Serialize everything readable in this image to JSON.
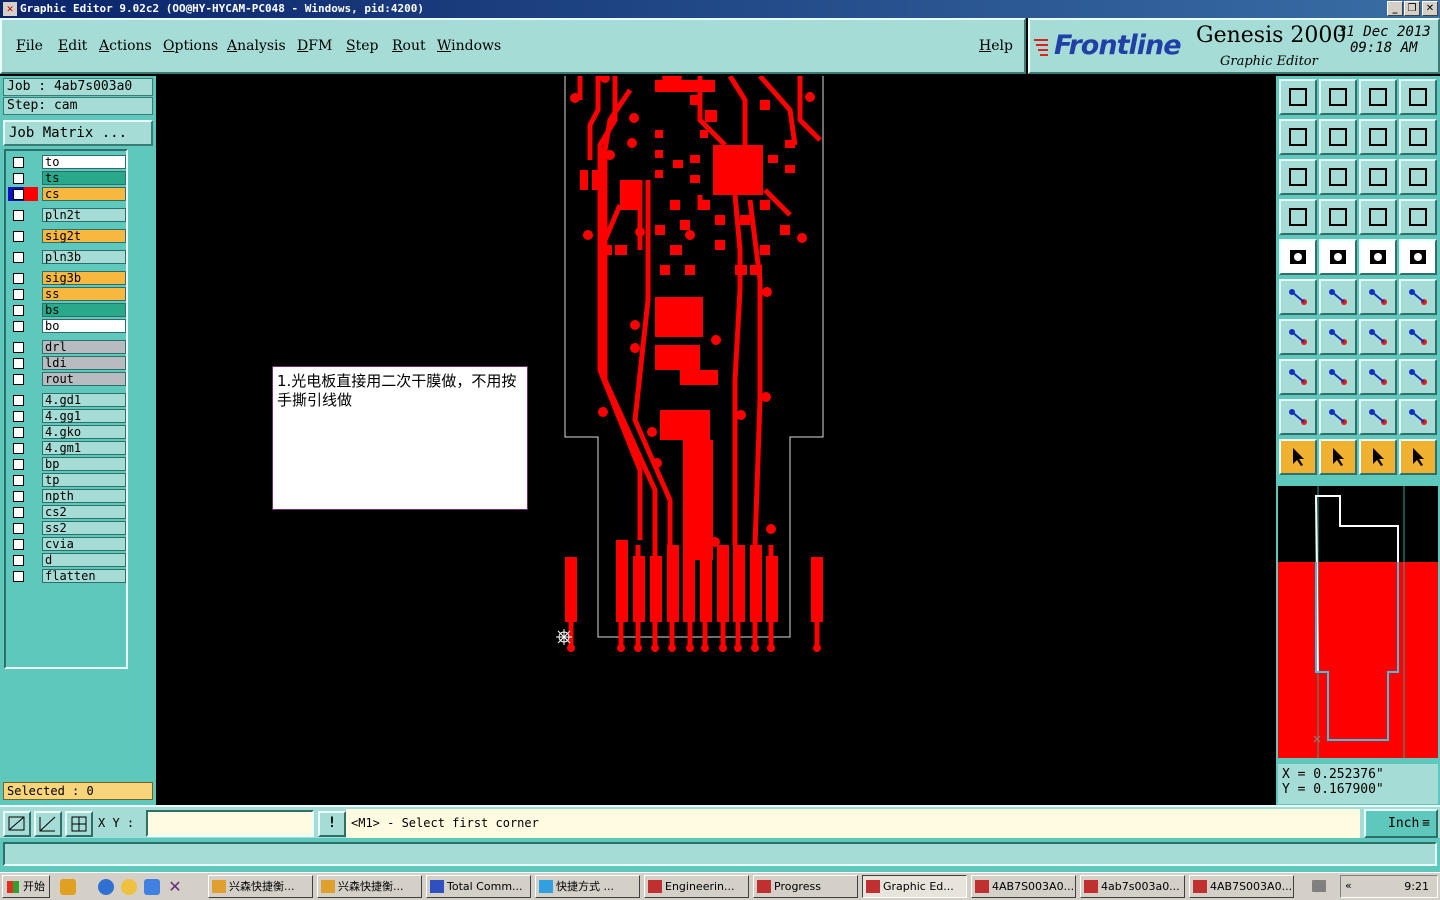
{
  "window": {
    "title": "Graphic Editor 9.02c2  (OO@HY-HYCAM-PC048 - Windows, pid:4200)",
    "buttons": {
      "minimize": "_",
      "maximize": "❐",
      "close": "✕"
    }
  },
  "menu": {
    "items": [
      "File",
      "Edit",
      "Actions",
      "Options",
      "Analysis",
      "DFM",
      "Step",
      "Rout",
      "Windows"
    ],
    "help": "Help"
  },
  "banner": {
    "logo": "Frontline",
    "product": "Genesis 2000",
    "subtitle": "Graphic Editor",
    "date": "31 Dec 2013",
    "time": "09:18 AM"
  },
  "job": {
    "job_line": "Job : 4ab7s003a0",
    "step_line": "Step: cam",
    "matrix_button": "Job Matrix ..."
  },
  "layers": [
    {
      "name": "to",
      "color": "#ffffff"
    },
    {
      "name": "ts",
      "color": "#2aa88a"
    },
    {
      "name": "cs",
      "color": "#f8b840"
    },
    {
      "name": "pln2t",
      "color": "#a6dcd6"
    },
    {
      "name": "sig2t",
      "color": "#f8b840"
    },
    {
      "name": "pln3b",
      "color": "#a6dcd6"
    },
    {
      "name": "sig3b",
      "color": "#f8b840"
    },
    {
      "name": "ss",
      "color": "#f8b840"
    },
    {
      "name": "bs",
      "color": "#2aa88a"
    },
    {
      "name": "bo",
      "color": "#ffffff"
    },
    {
      "name": "drl",
      "color": "#b8bcc0"
    },
    {
      "name": "ldi",
      "color": "#b8bcc0"
    },
    {
      "name": "rout",
      "color": "#b8bcc0"
    },
    {
      "name": "4.gd1",
      "color": "#a6dcd6"
    },
    {
      "name": "4.gg1",
      "color": "#a6dcd6"
    },
    {
      "name": "4.gko",
      "color": "#a6dcd6"
    },
    {
      "name": "4.gm1",
      "color": "#a6dcd6"
    },
    {
      "name": "bp",
      "color": "#a6dcd6"
    },
    {
      "name": "tp",
      "color": "#a6dcd6"
    },
    {
      "name": "npth",
      "color": "#a6dcd6"
    },
    {
      "name": "cs2",
      "color": "#a6dcd6"
    },
    {
      "name": "ss2",
      "color": "#a6dcd6"
    },
    {
      "name": "cvia",
      "color": "#a6dcd6"
    },
    {
      "name": "d",
      "color": "#a6dcd6"
    },
    {
      "name": "flatten",
      "color": "#a6dcd6"
    }
  ],
  "selected": "Selected : 0",
  "note": "1.光电板直接用二次干膜做，不用按手撕引线做",
  "coords": {
    "x": "X = 0.252376\"",
    "y": "Y = 0.167900\""
  },
  "bottom": {
    "xy_label": "X Y :",
    "xy_value": "",
    "warn": "!",
    "prompt": "<M1> - Select first corner",
    "unit": "Inch"
  },
  "taskbar": {
    "start": "开始",
    "tasks": [
      "兴森快捷衡...",
      "兴森快捷衡...",
      "Total Comm...",
      "快捷方式 ...",
      "Engineerin...",
      "Progress",
      "Graphic Ed...",
      "4AB7S003A0...",
      "4ab7s003a0...",
      "4AB7S003A0..."
    ],
    "active_index": 6,
    "clock": "9:21"
  },
  "colors": {
    "pcb": "#ff0000",
    "panel": "#5fc8bc",
    "panel_light": "#a6dcd6"
  }
}
